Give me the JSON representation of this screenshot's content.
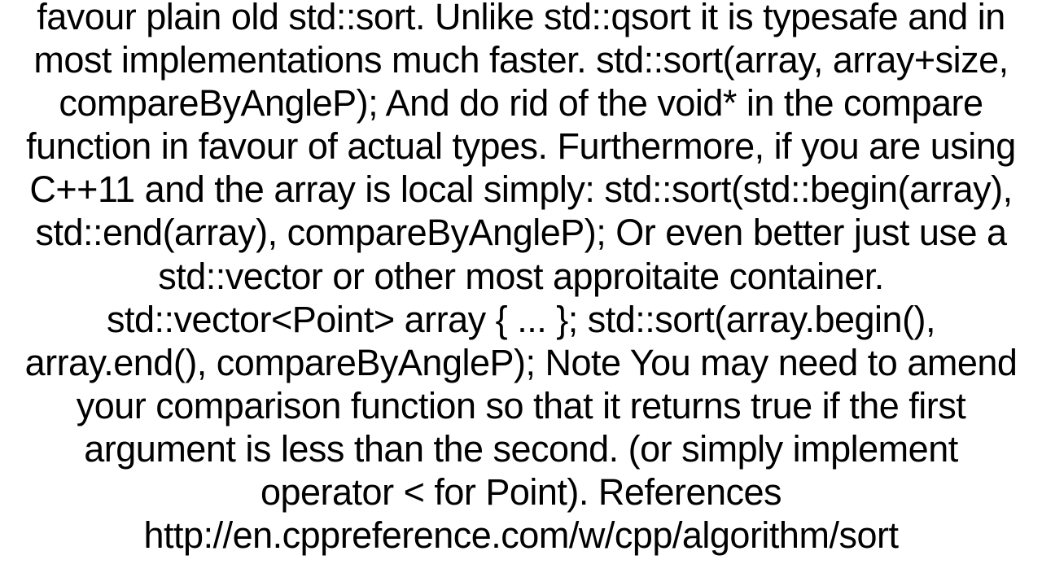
{
  "document": {
    "body_text": "favour plain old std::sort. Unlike std::qsort it is typesafe and in most implementations much faster. std::sort(array, array+size, compareByAngleP);  And do rid of the void* in the compare function in favour of actual types. Furthermore, if you are using C++11 and the array is local simply: std::sort(std::begin(array), std::end(array), compareByAngleP);  Or even better just use a std::vector or other most approitaite container. std::vector<Point> array { ... }; std::sort(array.begin(), array.end(), compareByAngleP);  Note You may need to amend your comparison function so that it returns true if the first argument is less than the second. (or simply implement operator < for Point). References http://en.cppreference.com/w/cpp/algorithm/sort"
  }
}
